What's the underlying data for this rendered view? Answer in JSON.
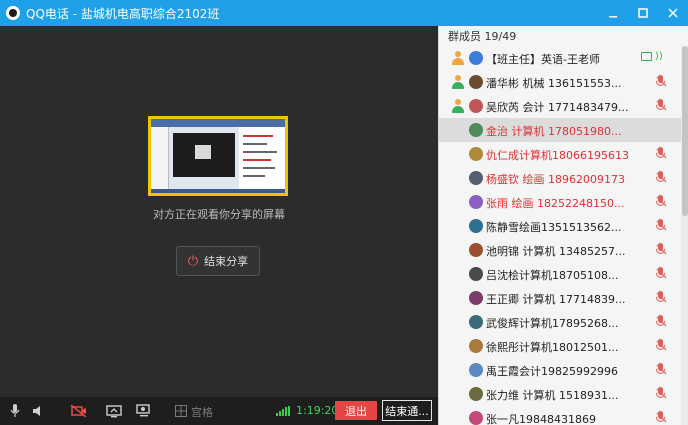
{
  "window": {
    "title": "QQ电话 - 盐城机电高职综合2102班",
    "minimize_icon": "minimize-icon",
    "maximize_icon": "maximize-icon",
    "close_icon": "close-icon"
  },
  "share": {
    "caption": "对方正在观看你分享的屏幕",
    "end_label": "结束分享"
  },
  "toolbar": {
    "grid_label": "宫格",
    "timer": "1:19:20",
    "exit_label": "退出",
    "end_call_label": "结束通..."
  },
  "panel": {
    "title": "群成员 19/49",
    "members": [
      {
        "name": "【班主任】英语-王老师",
        "status": "speaking-screen"
      },
      {
        "name": "潘华彬 机械 136151553...",
        "status": "muted"
      },
      {
        "name": "吴欣芮 会计 1771483479...",
        "status": "muted"
      },
      {
        "name": "金治 计算机 178051980...",
        "status": "none",
        "selected": true,
        "red": true
      },
      {
        "name": "仇仁成计算机18066195613",
        "status": "muted",
        "red": true
      },
      {
        "name": "杨盛钦 绘画 18962009173",
        "status": "muted",
        "red": true
      },
      {
        "name": "张雨 绘画 18252248150...",
        "status": "muted",
        "red": true
      },
      {
        "name": "陈静雪绘画1351513562...",
        "status": "muted"
      },
      {
        "name": "池明锦 计算机 13485257...",
        "status": "muted"
      },
      {
        "name": "吕沈桧计算机18705108...",
        "status": "muted"
      },
      {
        "name": "王正卿 计算机 17714839...",
        "status": "muted"
      },
      {
        "name": "武俊辉计算机17895268...",
        "status": "muted"
      },
      {
        "name": "徐熙彤计算机18012501...",
        "status": "muted"
      },
      {
        "name": "禹王霞会计19825992996",
        "status": "muted"
      },
      {
        "name": "张力维 计算机 1518931...",
        "status": "muted"
      },
      {
        "name": "张一凡19848431869",
        "status": "muted"
      }
    ]
  },
  "colors": {
    "titlebar": "#1ea1e8",
    "exit_button": "#e64545",
    "timer": "#46d15a",
    "highlight_red": "#e03030",
    "share_border": "#f0c400"
  }
}
